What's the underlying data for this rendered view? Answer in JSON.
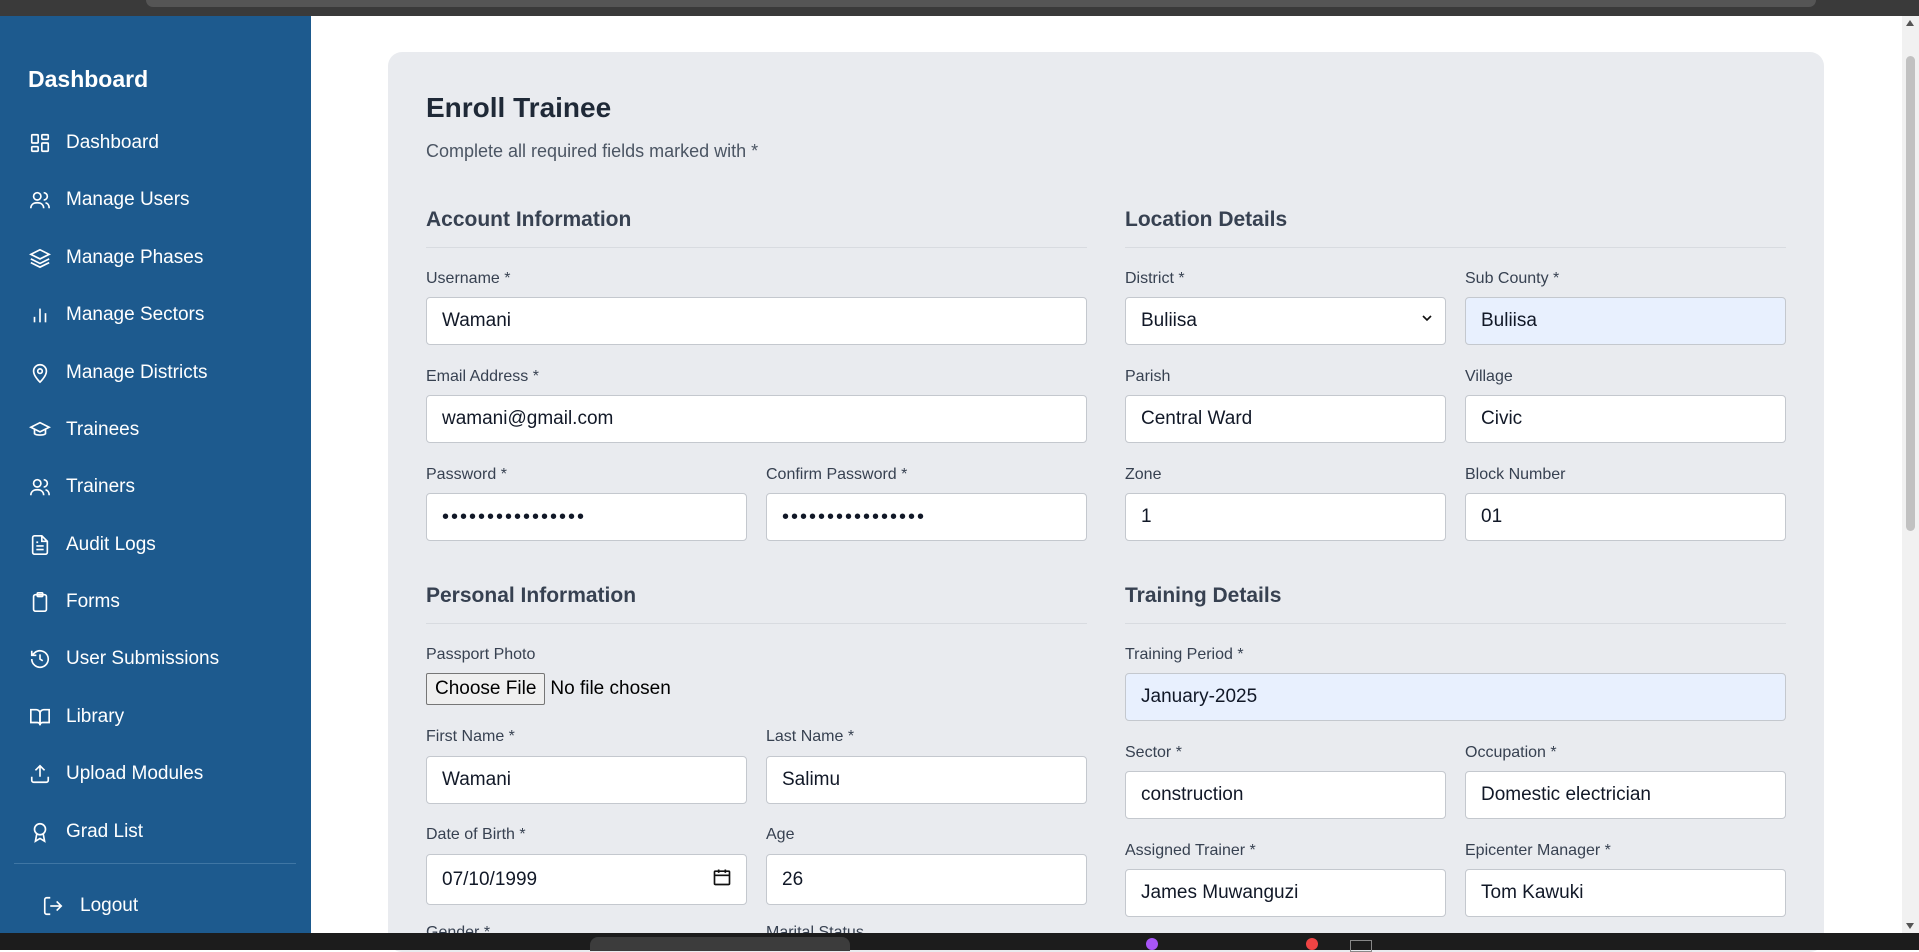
{
  "sidebar": {
    "brand": "Dashboard",
    "items": [
      {
        "label": "Dashboard",
        "icon": "dashboard-grid-icon"
      },
      {
        "label": "Manage Users",
        "icon": "users-icon"
      },
      {
        "label": "Manage Phases",
        "icon": "layers-icon"
      },
      {
        "label": "Manage Sectors",
        "icon": "bar-chart-icon"
      },
      {
        "label": "Manage Districts",
        "icon": "map-pin-icon"
      },
      {
        "label": "Trainees",
        "icon": "graduation-cap-icon"
      },
      {
        "label": "Trainers",
        "icon": "users-icon"
      },
      {
        "label": "Audit Logs",
        "icon": "file-text-icon"
      },
      {
        "label": "Forms",
        "icon": "clipboard-icon"
      },
      {
        "label": "User Submissions",
        "icon": "history-icon"
      },
      {
        "label": "Library",
        "icon": "book-icon"
      },
      {
        "label": "Upload Modules",
        "icon": "upload-icon"
      },
      {
        "label": "Grad List",
        "icon": "award-icon"
      }
    ],
    "logout": "Logout"
  },
  "form": {
    "title": "Enroll Trainee",
    "subtitle": "Complete all required fields marked with *",
    "account": {
      "title": "Account Information",
      "username_label": "Username *",
      "username": "Wamani",
      "email_label": "Email Address *",
      "email": "wamani@gmail.com",
      "password_label": "Password *",
      "password": "••••••••••••••••",
      "confirm_label": "Confirm Password *",
      "confirm": "••••••••••••••••"
    },
    "personal": {
      "title": "Personal Information",
      "photo_label": "Passport Photo",
      "choose_file": "Choose File",
      "file_status": "No file chosen",
      "first_name_label": "First Name *",
      "first_name": "Wamani",
      "last_name_label": "Last Name *",
      "last_name": "Salimu",
      "dob_label": "Date of Birth *",
      "dob": "07/10/1999",
      "age_label": "Age",
      "age": "26",
      "gender_label": "Gender *",
      "marital_label": "Marital Status"
    },
    "location": {
      "title": "Location Details",
      "district_label": "District *",
      "district": "Buliisa",
      "subcounty_label": "Sub County *",
      "subcounty": "Buliisa",
      "parish_label": "Parish",
      "parish": "Central Ward",
      "village_label": "Village",
      "village": "Civic",
      "zone_label": "Zone",
      "zone": "1",
      "block_label": "Block Number",
      "block": "01"
    },
    "training": {
      "title": "Training Details",
      "period_label": "Training Period *",
      "period": "January-2025",
      "sector_label": "Sector *",
      "sector": "construction",
      "occupation_label": "Occupation *",
      "occupation": "Domestic electrician",
      "trainer_label": "Assigned Trainer *",
      "trainer": "James Muwanguzi",
      "manager_label": "Epicenter Manager *",
      "manager": "Tom Kawuki"
    }
  },
  "colors": {
    "sidebar_bg": "#1d5a8e",
    "card_bg": "#e9ebef",
    "autofill_bg": "#e8f0fe"
  }
}
